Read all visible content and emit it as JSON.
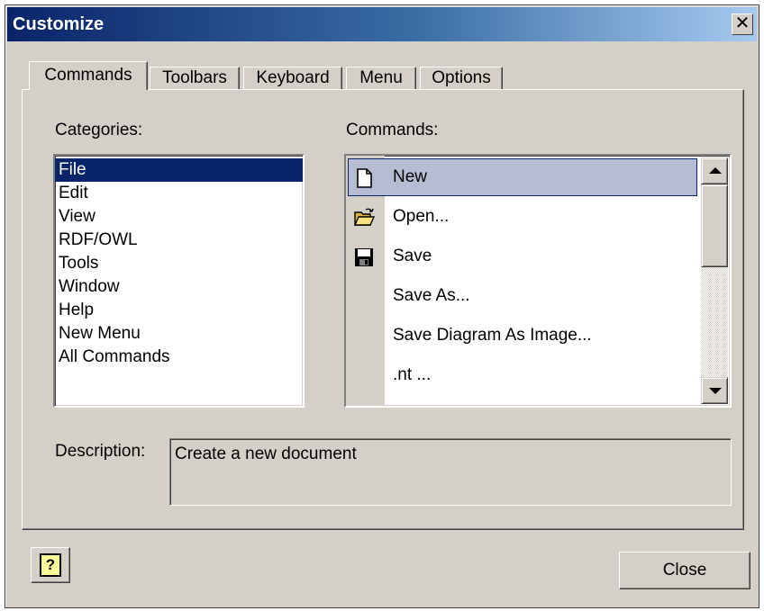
{
  "window": {
    "title": "Customize",
    "close_glyph": "✕"
  },
  "tabs": [
    {
      "label": "Commands",
      "active": true
    },
    {
      "label": "Toolbars",
      "active": false
    },
    {
      "label": "Keyboard",
      "active": false
    },
    {
      "label": "Menu",
      "active": false
    },
    {
      "label": "Options",
      "active": false
    }
  ],
  "categories": {
    "label": "Categories:",
    "items": [
      "File",
      "Edit",
      "View",
      "RDF/OWL",
      "Tools",
      "Window",
      "Help",
      "New Menu",
      "All Commands"
    ],
    "selected": "File"
  },
  "commands": {
    "label": "Commands:",
    "items": [
      {
        "label": "New",
        "icon": "new-document-icon",
        "selected": true
      },
      {
        "label": "Open...",
        "icon": "open-folder-icon",
        "selected": false
      },
      {
        "label": "Save",
        "icon": "save-disk-icon",
        "selected": false
      },
      {
        "label": "Save As...",
        "icon": "",
        "selected": false
      },
      {
        "label": "Save Diagram As Image...",
        "icon": "",
        "selected": false
      },
      {
        "label": ".nt ...",
        "icon": "",
        "selected": false
      }
    ]
  },
  "description": {
    "label": "Description:",
    "text": "Create a new document"
  },
  "buttons": {
    "help_glyph": "?",
    "close": "Close"
  },
  "colors": {
    "title_gradient_start": "#0a246a",
    "title_gradient_end": "#a6caf0",
    "selection": "#0a246a",
    "face": "#d4d0c8"
  }
}
